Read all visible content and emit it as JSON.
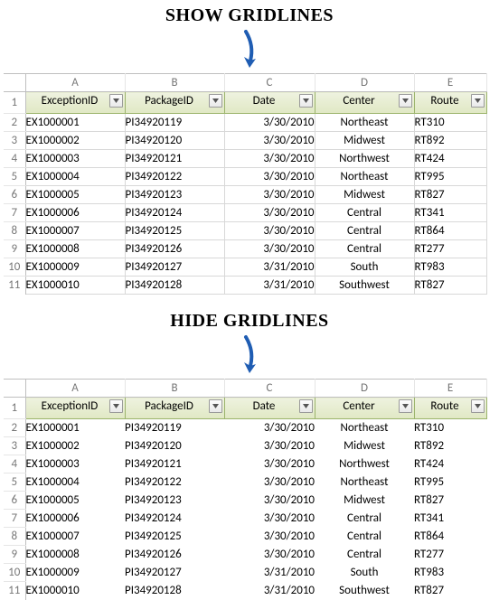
{
  "annotations": {
    "show": "SHOW GRIDLINES",
    "hide": "HIDE GRIDLINES"
  },
  "columns": [
    "A",
    "B",
    "C",
    "D",
    "E"
  ],
  "headers": {
    "exceptionId": "ExceptionID",
    "packageId": "PackageID",
    "date": "Date",
    "center": "Center",
    "route": "Route"
  },
  "rows": [
    {
      "n": "1"
    },
    {
      "n": "2",
      "exceptionId": "EX1000001",
      "packageId": "PI34920119",
      "date": "3/30/2010",
      "center": "Northeast",
      "route": "RT310"
    },
    {
      "n": "3",
      "exceptionId": "EX1000002",
      "packageId": "PI34920120",
      "date": "3/30/2010",
      "center": "Midwest",
      "route": "RT892"
    },
    {
      "n": "4",
      "exceptionId": "EX1000003",
      "packageId": "PI34920121",
      "date": "3/30/2010",
      "center": "Northwest",
      "route": "RT424"
    },
    {
      "n": "5",
      "exceptionId": "EX1000004",
      "packageId": "PI34920122",
      "date": "3/30/2010",
      "center": "Northeast",
      "route": "RT995"
    },
    {
      "n": "6",
      "exceptionId": "EX1000005",
      "packageId": "PI34920123",
      "date": "3/30/2010",
      "center": "Midwest",
      "route": "RT827"
    },
    {
      "n": "7",
      "exceptionId": "EX1000006",
      "packageId": "PI34920124",
      "date": "3/30/2010",
      "center": "Central",
      "route": "RT341"
    },
    {
      "n": "8",
      "exceptionId": "EX1000007",
      "packageId": "PI34920125",
      "date": "3/30/2010",
      "center": "Central",
      "route": "RT864"
    },
    {
      "n": "9",
      "exceptionId": "EX1000008",
      "packageId": "PI34920126",
      "date": "3/30/2010",
      "center": "Central",
      "route": "RT277"
    },
    {
      "n": "10",
      "exceptionId": "EX1000009",
      "packageId": "PI34920127",
      "date": "3/31/2010",
      "center": "South",
      "route": "RT983"
    },
    {
      "n": "11",
      "exceptionId": "EX1000010",
      "packageId": "PI34920128",
      "date": "3/31/2010",
      "center": "Southwest",
      "route": "RT827"
    }
  ]
}
